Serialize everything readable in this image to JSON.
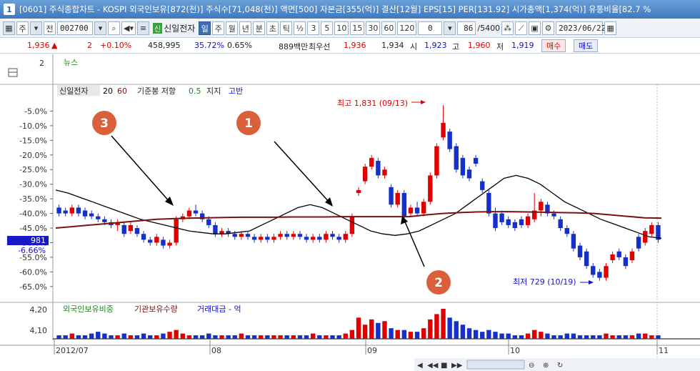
{
  "window": {
    "icon_label": "1",
    "title": "[0601] 주식종합차트 - KOSPI 외국인보유[872(천)] 주식수[71,048(천)] 액면[500] 자본금[355(억)] 결산[12월] EPS[15] PER[131.92] 시가총액[1,374(억)] 유통비율[82.7 %"
  },
  "toolbar": {
    "market": "주",
    "all_label": "전",
    "code": "002700",
    "stock_name": "신일전자",
    "stock_badge": "신",
    "periods": [
      "일",
      "주",
      "월",
      "년",
      "분",
      "초",
      "틱"
    ],
    "ratio_label": "½",
    "intervals": [
      "3",
      "5",
      "10",
      "15",
      "30",
      "60",
      "120"
    ],
    "interval_value": "0",
    "count": "86",
    "count_total": "/5400",
    "date": "2023/06/22"
  },
  "quote": {
    "price": "1,936",
    "change_arrow": "▲",
    "change": "2",
    "change_pct": "+0.10%",
    "volume": "458,995",
    "vol_ratio": "35.72%",
    "turnover": "0.65%",
    "amount": "889백만",
    "pref_label": "최우선",
    "pref_value": "1,936",
    "bid": "1,934",
    "open_label": "시",
    "open": "1,923",
    "high_label": "고",
    "high": "1,960",
    "low_label": "저",
    "low": "1,919",
    "buy_label": "매수",
    "sell_label": "매도"
  },
  "news_panel": {
    "axis_value": "2",
    "label": "뉴스"
  },
  "price_legend": {
    "name": "신일전자",
    "ma_short": "20",
    "ma_long": "60",
    "ref_label": "기준봉 저항",
    "ref_ratio": "0.5",
    "support_label": "지지",
    "break_label": "고반"
  },
  "volume_legend": {
    "item1": "외국인보유비중",
    "item2": "기관보유수량",
    "item3": "거래대금 - 억"
  },
  "annotations": {
    "high": "최고 1,831 (09/13)",
    "low": "최저 729 (10/19)",
    "markers": [
      "1",
      "2",
      "3"
    ],
    "current_price_tag": "981",
    "current_pct_tag": "-6.66%"
  },
  "colors": {
    "up": "#e00000",
    "down": "#1530c8",
    "ma20": "#000000",
    "ma60": "#7a1010",
    "marker": "#d9603a"
  },
  "chart_data": {
    "type": "candlestick",
    "y_unit": "% change",
    "ylim": [
      -67,
      0
    ],
    "y_ticks": [
      "-5.0%",
      "-10.0%",
      "-15.0%",
      "-20.0%",
      "-25.0%",
      "-30.0%",
      "-35.0%",
      "-40.0%",
      "-45.0%",
      "-50.0%",
      "-55.0%",
      "-60.0%",
      "-65.0%"
    ],
    "x_ticks": [
      "2012/07",
      "08",
      "09",
      "10",
      "11"
    ],
    "volume_y_ticks": [
      "4,20",
      "4,10"
    ],
    "series_names": [
      "신일전자",
      "20",
      "60"
    ],
    "candles": [
      [
        -38,
        -40,
        -37,
        -41
      ],
      [
        -39,
        -40,
        -38,
        -41
      ],
      [
        -40,
        -38,
        -37,
        -41
      ],
      [
        -38,
        -40,
        -37,
        -41
      ],
      [
        -39,
        -41,
        -38,
        -42
      ],
      [
        -40,
        -41,
        -39,
        -42
      ],
      [
        -41,
        -42,
        -40,
        -43
      ],
      [
        -42,
        -43,
        -41,
        -44
      ],
      [
        -43,
        -44,
        -42,
        -45
      ],
      [
        -44,
        -43,
        -42,
        -46
      ],
      [
        -44,
        -47,
        -43,
        -48
      ],
      [
        -46,
        -44,
        -43,
        -47
      ],
      [
        -45,
        -47,
        -44,
        -48
      ],
      [
        -47,
        -49,
        -46,
        -50
      ],
      [
        -49,
        -50,
        -48,
        -51
      ],
      [
        -50,
        -48,
        -47,
        -51
      ],
      [
        -49,
        -51,
        -48,
        -52
      ],
      [
        -51,
        -50,
        -49,
        -52
      ],
      [
        -50,
        -42,
        -41,
        -51
      ],
      [
        -42,
        -41,
        -40,
        -43
      ],
      [
        -41,
        -39,
        -38,
        -42
      ],
      [
        -39,
        -40,
        -37,
        -41
      ],
      [
        -40,
        -42,
        -39,
        -43
      ],
      [
        -42,
        -44,
        -41,
        -45
      ],
      [
        -44,
        -47,
        -43,
        -48
      ],
      [
        -47,
        -46,
        -45,
        -48
      ],
      [
        -46,
        -47,
        -45,
        -48
      ],
      [
        -47,
        -48,
        -46,
        -49
      ],
      [
        -48,
        -47,
        -46,
        -49
      ],
      [
        -47,
        -48,
        -46,
        -49
      ],
      [
        -48,
        -49,
        -47,
        -50
      ],
      [
        -49,
        -48,
        -47,
        -50
      ],
      [
        -48,
        -49,
        -47,
        -50
      ],
      [
        -49,
        -48,
        -47,
        -50
      ],
      [
        -48,
        -47,
        -46,
        -49
      ],
      [
        -47,
        -48,
        -46,
        -49
      ],
      [
        -48,
        -47,
        -46,
        -49
      ],
      [
        -47,
        -48,
        -46,
        -49
      ],
      [
        -48,
        -49,
        -47,
        -50
      ],
      [
        -49,
        -48,
        -47,
        -50
      ],
      [
        -48,
        -49,
        -47,
        -50
      ],
      [
        -49,
        -47,
        -46,
        -50
      ],
      [
        -47,
        -48,
        -46,
        -49
      ],
      [
        -48,
        -49,
        -47,
        -50
      ],
      [
        -49,
        -47,
        -46,
        -50
      ],
      [
        -47,
        -41,
        -40,
        -48
      ],
      [
        -33,
        -32,
        -31,
        -34
      ],
      [
        -29,
        -24,
        -23,
        -30
      ],
      [
        -24,
        -21,
        -20,
        -25
      ],
      [
        -22,
        -27,
        -21,
        -28
      ],
      [
        -27,
        -25,
        -24,
        -28
      ],
      [
        -31,
        -37,
        -30,
        -38
      ],
      [
        -37,
        -33,
        -32,
        -38
      ],
      [
        -33,
        -41,
        -32,
        -42
      ],
      [
        -40,
        -38,
        -37,
        -41
      ],
      [
        -38,
        -40,
        -36,
        -41
      ],
      [
        -40,
        -36,
        -35,
        -41
      ],
      [
        -36,
        -27,
        -26,
        -37
      ],
      [
        -27,
        -17,
        -16,
        -28
      ],
      [
        -14,
        -9,
        -3,
        -15
      ],
      [
        -12,
        -18,
        -11,
        -19
      ],
      [
        -17,
        -25,
        -16,
        -26
      ],
      [
        -21,
        -27,
        -20,
        -28
      ],
      [
        -25,
        -28,
        -24,
        -29
      ],
      [
        -21,
        -23,
        -20,
        -24
      ],
      [
        -29,
        -32,
        -28,
        -33
      ],
      [
        -33,
        -40,
        -32,
        -41
      ],
      [
        -40,
        -45,
        -38,
        -46
      ],
      [
        -40,
        -43,
        -39,
        -44
      ],
      [
        -42,
        -44,
        -41,
        -45
      ],
      [
        -43,
        -45,
        -42,
        -46
      ],
      [
        -42,
        -44,
        -41,
        -45
      ],
      [
        -44,
        -41,
        -40,
        -45
      ],
      [
        -42,
        -39,
        -33,
        -43
      ],
      [
        -39,
        -36,
        -35,
        -41
      ],
      [
        -37,
        -40,
        -36,
        -41
      ],
      [
        -40,
        -41,
        -39,
        -42
      ],
      [
        -42,
        -45,
        -41,
        -46
      ],
      [
        -45,
        -47,
        -44,
        -48
      ],
      [
        -47,
        -52,
        -46,
        -53
      ],
      [
        -51,
        -55,
        -50,
        -56
      ],
      [
        -53,
        -58,
        -52,
        -59
      ],
      [
        -58,
        -61,
        -57,
        -62
      ],
      [
        -60,
        -62,
        -59,
        -63
      ],
      [
        -62,
        -58,
        -57,
        -63
      ],
      [
        -56,
        -54,
        -53,
        -57
      ],
      [
        -53,
        -55,
        -52,
        -56
      ],
      [
        -55,
        -58,
        -54,
        -59
      ],
      [
        -56,
        -53,
        -52,
        -57
      ],
      [
        -48,
        -52,
        -47,
        -53
      ],
      [
        -50,
        -46,
        -45,
        -51
      ],
      [
        -47,
        -44,
        -43,
        -48
      ],
      [
        -44,
        -49,
        -43,
        -50
      ]
    ],
    "ma20": [
      -32,
      -33,
      -34.5,
      -36,
      -37.5,
      -39,
      -40.5,
      -42,
      -43,
      -44,
      -45,
      -46,
      -46.5,
      -47,
      -47,
      -46.5,
      -46,
      -44,
      -42,
      -40,
      -38,
      -37,
      -38,
      -40,
      -42,
      -44,
      -46,
      -47,
      -47.5,
      -47,
      -46,
      -44,
      -42,
      -40,
      -37,
      -34,
      -31,
      -28,
      -27,
      -28,
      -30,
      -33,
      -36,
      -38,
      -40,
      -42,
      -43.5,
      -45,
      -46.5,
      -48,
      -48.5
    ],
    "ma60": [
      -45,
      -44.5,
      -44,
      -43.5,
      -43,
      -42.5,
      -42,
      -41.8,
      -41.6,
      -41.5,
      -41.4,
      -41.3,
      -41.3,
      -41.3,
      -41.2,
      -41.2,
      -41.2,
      -41.1,
      -41.1,
      -41.1,
      -41.1,
      -41.1,
      -40.5,
      -40,
      -39.7,
      -39.5,
      -39.4,
      -39.4,
      -39.5,
      -39.6,
      -39.7,
      -39.8,
      -40,
      -40.5,
      -41,
      -41.5,
      -41.6
    ],
    "volume": [
      2,
      2,
      3,
      2,
      2,
      3,
      4,
      3,
      2,
      2,
      3,
      2,
      2,
      3,
      2,
      2,
      3,
      4,
      5,
      3,
      2,
      2,
      2,
      3,
      2,
      2,
      2,
      2,
      3,
      2,
      2,
      2,
      2,
      2,
      2,
      2,
      2,
      2,
      2,
      3,
      2,
      2,
      2,
      2,
      3,
      5,
      12,
      8,
      11,
      9,
      10,
      6,
      5,
      5,
      4,
      4,
      6,
      11,
      14,
      17,
      12,
      10,
      8,
      6,
      5,
      4,
      5,
      4,
      3,
      3,
      2,
      2,
      3,
      5,
      4,
      3,
      2,
      2,
      3,
      3,
      2,
      2,
      2,
      2,
      3,
      2,
      2,
      2,
      2,
      3,
      3,
      2,
      2
    ]
  }
}
